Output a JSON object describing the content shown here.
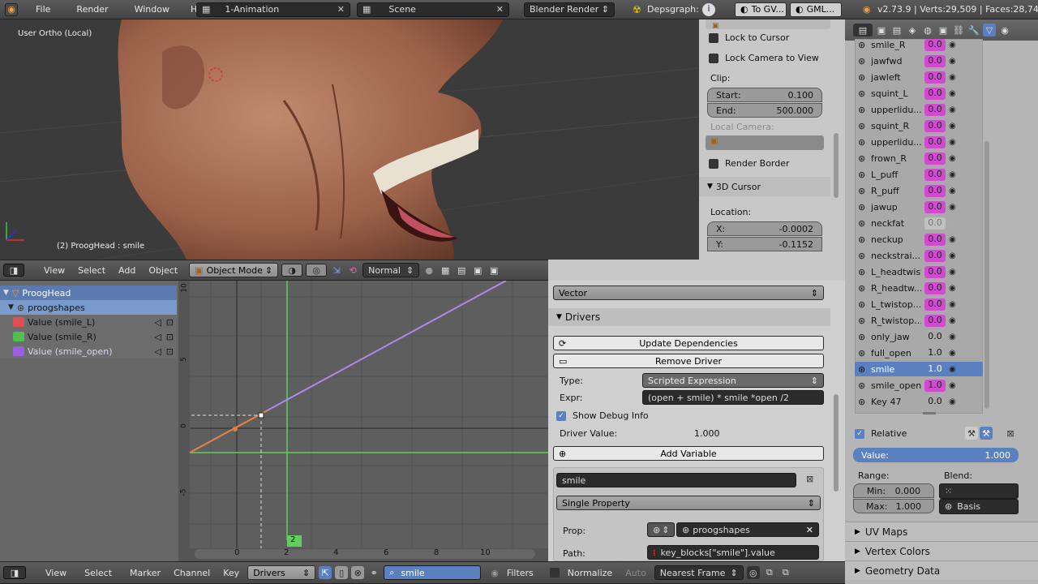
{
  "topbar": {
    "menus": [
      "File",
      "Render",
      "Window",
      "Help"
    ],
    "layout": "1-Animation",
    "scene": "Scene",
    "engine": "Blender Render",
    "depsgraph": "Depsgraph:",
    "to_gv": "To GV...",
    "gml": "GML...",
    "stats": "v2.73.9 | Verts:29,509 | Faces:28,74"
  },
  "viewport": {
    "title": "User Ortho (Local)",
    "object_label": "(2) ProogHead : smile"
  },
  "npanel": {
    "lock_cursor": "Lock to Cursor",
    "lock_camera": "Lock Camera to View",
    "clip": "Clip:",
    "start_label": "Start:",
    "start_value": "0.100",
    "end_label": "End:",
    "end_value": "500.000",
    "local_camera": "Local Camera:",
    "render_border": "Render Border",
    "cursor_title": "3D Cursor",
    "location": "Location:",
    "x_label": "X:",
    "x_value": "-0.0002",
    "y_label": "Y:",
    "y_value": "-0.1152"
  },
  "viewport_header": {
    "view": "View",
    "select": "Select",
    "add": "Add",
    "object": "Object",
    "mode": "Object Mode",
    "shading": "Normal"
  },
  "channels": {
    "obj": "ProogHead",
    "shapes": "proogshapes",
    "items": [
      {
        "label": "Value (smile_L)",
        "color": "#e05050"
      },
      {
        "label": "Value (smile_R)",
        "color": "#50c050"
      },
      {
        "label": "Value (smile_open)",
        "color": "#9a60e0"
      }
    ]
  },
  "graph": {
    "y_ticks": [
      "10",
      "5",
      "0",
      "-5"
    ],
    "x_ticks": [
      "0",
      "2",
      "4",
      "6",
      "8",
      "10"
    ],
    "frame": "2"
  },
  "drivers": {
    "vector": "Vector",
    "drivers_title": "Drivers",
    "update": "Update Dependencies",
    "remove": "Remove Driver",
    "type_label": "Type:",
    "type_value": "Scripted Expression",
    "expr_label": "Expr:",
    "expr_value": "(open + smile) * smile *open /2",
    "debug": "Show Debug Info",
    "driver_value_label": "Driver Value:",
    "driver_value": "1.000",
    "add_var": "Add Variable",
    "var_name": "smile",
    "var_type": "Single Property",
    "prop_label": "Prop:",
    "prop_value": "proogshapes",
    "path_label": "Path:",
    "path_value": "key_blocks[\"smile\"].value"
  },
  "bottom": {
    "view": "View",
    "select": "Select",
    "marker": "Marker",
    "channel": "Channel",
    "key": "Key",
    "mode": "Drivers",
    "search": "smile",
    "filters": "Filters",
    "normalize": "Normalize",
    "auto": "Auto",
    "interp": "Nearest Frame"
  },
  "shapekeys": [
    {
      "name": "smile_R",
      "value": "0.0",
      "style": "pink"
    },
    {
      "name": "jawfwd",
      "value": "0.0",
      "style": "pink"
    },
    {
      "name": "jawleft",
      "value": "0.0",
      "style": "pink"
    },
    {
      "name": "squint_L",
      "value": "0.0",
      "style": "pink"
    },
    {
      "name": "upperlidu...",
      "value": "0.0",
      "style": "pink"
    },
    {
      "name": "squint_R",
      "value": "0.0",
      "style": "pink"
    },
    {
      "name": "upperlidu...",
      "value": "0.0",
      "style": "pink"
    },
    {
      "name": "frown_R",
      "value": "0.0",
      "style": "pink"
    },
    {
      "name": "L_puff",
      "value": "0.0",
      "style": "pink"
    },
    {
      "name": "R_puff",
      "value": "0.0",
      "style": "pink"
    },
    {
      "name": "jawup",
      "value": "0.0",
      "style": "pink"
    },
    {
      "name": "neckfat",
      "value": "0.0",
      "style": "dis"
    },
    {
      "name": "neckup",
      "value": "0.0",
      "style": "pink"
    },
    {
      "name": "neckstrai...",
      "value": "0.0",
      "style": "pink"
    },
    {
      "name": "L_headtwist",
      "value": "0.0",
      "style": "pink"
    },
    {
      "name": "R_headtw...",
      "value": "0.0",
      "style": "pink"
    },
    {
      "name": "L_twistop...",
      "value": "0.0",
      "style": "pink"
    },
    {
      "name": "R_twistop...",
      "value": "0.0",
      "style": "pink"
    },
    {
      "name": "only_jaw",
      "value": "0.0",
      "style": "plain"
    },
    {
      "name": "full_open",
      "value": "1.0",
      "style": "plain"
    },
    {
      "name": "smile",
      "value": "1.0",
      "style": "sel"
    },
    {
      "name": "smile_open",
      "value": "1.0",
      "style": "pink"
    },
    {
      "name": "Key 47",
      "value": "0.0",
      "style": "plain"
    }
  ],
  "props": {
    "relative": "Relative",
    "value_label": "Value:",
    "value": "1.000",
    "range": "Range:",
    "min_label": "Min:",
    "min": "0.000",
    "max_label": "Max:",
    "max": "1.000",
    "blend": "Blend:",
    "basis": "Basis",
    "uv_maps": "UV Maps",
    "vertex_colors": "Vertex Colors",
    "geometry_data": "Geometry Data"
  }
}
